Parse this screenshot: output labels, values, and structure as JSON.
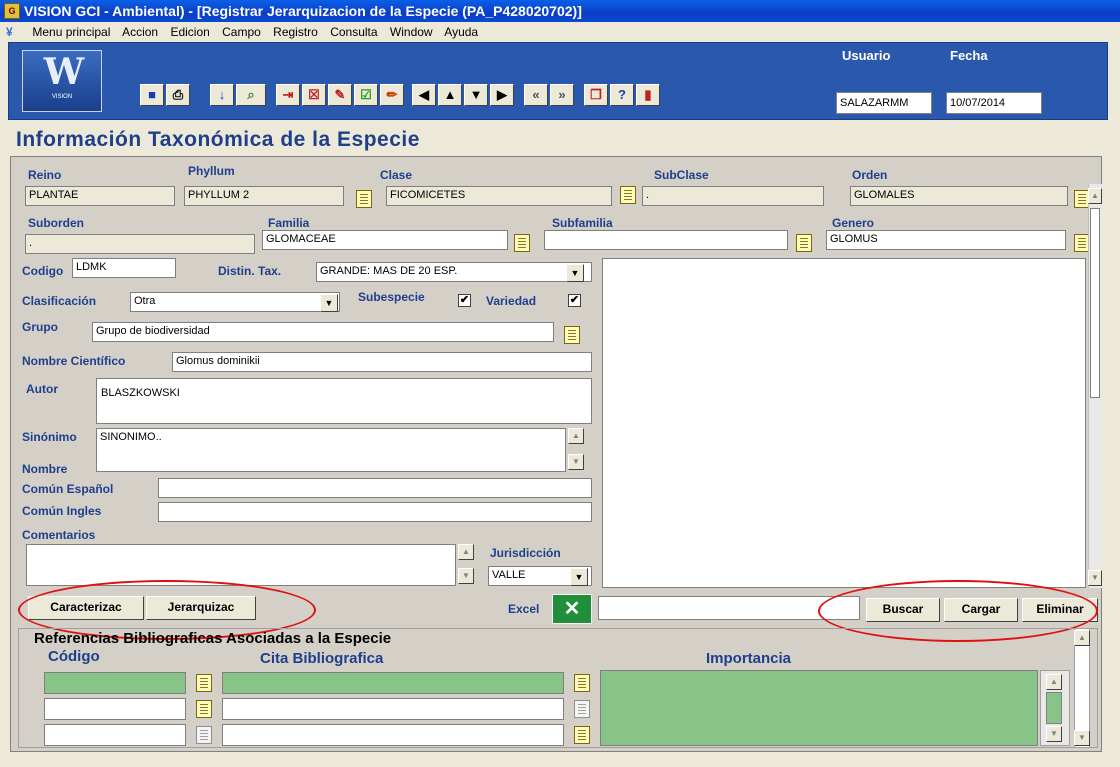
{
  "window": {
    "title": "VISION GCI - Ambiental) - [Registrar Jerarquizacion de la Especie  (PA_P428020702)]"
  },
  "menu": {
    "items": [
      "Menu principal",
      "Accion",
      "Edicion",
      "Campo",
      "Registro",
      "Consulta",
      "Window",
      "Ayuda"
    ]
  },
  "toolbar": {
    "logo_text": "VISION",
    "usuario_label": "Usuario",
    "usuario_value": "SALAZARMM",
    "fecha_label": "Fecha",
    "fecha_value": "10/07/2014"
  },
  "form": {
    "heading": "Información Taxonómica de la Especie",
    "reino": {
      "label": "Reino",
      "value": "PLANTAE"
    },
    "phyllum": {
      "label": "Phyllum",
      "value": "PHYLLUM 2"
    },
    "clase": {
      "label": "Clase",
      "value": "FICOMICETES"
    },
    "subclase": {
      "label": "SubClase",
      "value": "."
    },
    "orden": {
      "label": "Orden",
      "value": "GLOMALES"
    },
    "suborden": {
      "label": "Suborden",
      "value": "."
    },
    "familia": {
      "label": "Familia",
      "value": "GLOMACEAE"
    },
    "subfamilia": {
      "label": "Subfamilia",
      "value": ""
    },
    "genero": {
      "label": "Genero",
      "value": "GLOMUS"
    },
    "codigo": {
      "label": "Codigo",
      "value": "LDMK"
    },
    "distin_tax": {
      "label": "Distin. Tax.",
      "value": "GRANDE: MAS DE 20 ESP."
    },
    "clasificacion": {
      "label": "Clasificación",
      "value": "Otra"
    },
    "subespecie": {
      "label": "Subespecie",
      "checked": true
    },
    "variedad": {
      "label": "Variedad",
      "checked": true
    },
    "grupo": {
      "label": "Grupo",
      "value": "Grupo de biodiversidad"
    },
    "nombre_cientifico": {
      "label": "Nombre Científico",
      "value": "Glomus dominikii"
    },
    "autor": {
      "label": "Autor",
      "value": "BLASZKOWSKI"
    },
    "sinonimo": {
      "label": "Sinónimo",
      "value": "SINONIMO.."
    },
    "nombre_label": "Nombre",
    "comun_espanol": {
      "label": "Común Español",
      "value": ""
    },
    "comun_ingles": {
      "label": "Común Ingles",
      "value": ""
    },
    "comentarios": {
      "label": "Comentarios",
      "value": ""
    },
    "jurisdiccion": {
      "label": "Jurisdicción",
      "value": "VALLE"
    },
    "check_mark": "✔"
  },
  "buttons": {
    "caracterizac": "Caracterizac",
    "jerarquizac": "Jerarquizac",
    "excel_label": "Excel",
    "buscar": "Buscar",
    "cargar": "Cargar",
    "eliminar": "Eliminar"
  },
  "references": {
    "title": "Referencias Bibliograficas Asociadas a la Especie",
    "col_codigo": "Código",
    "col_cita": "Cita Bibliografica",
    "col_importancia": "Importancia"
  },
  "colors": {
    "label_blue": "#1f3f8c",
    "grid_green": "#88c488",
    "highlight_red": "#e01010"
  }
}
